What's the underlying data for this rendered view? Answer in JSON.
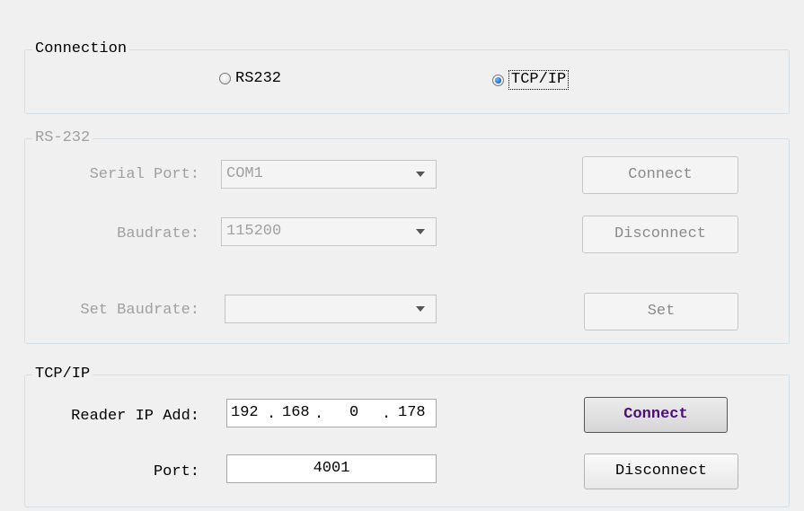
{
  "connection": {
    "title": "Connection",
    "options": [
      {
        "label": "RS232",
        "checked": false
      },
      {
        "label": "TCP/IP",
        "checked": true
      }
    ]
  },
  "rs232": {
    "title": "RS-232",
    "serial_port_label": "Serial Port:",
    "serial_port_value": "COM1",
    "baudrate_label": "Baudrate:",
    "baudrate_value": "115200",
    "set_baudrate_label": "Set Baudrate:",
    "set_baudrate_value": "",
    "connect_label": "Connect",
    "disconnect_label": "Disconnect",
    "set_label": "Set"
  },
  "tcpip": {
    "title": "TCP/IP",
    "ip_label": "Reader IP Add:",
    "ip_octets": [
      "192",
      "168",
      "0",
      "178"
    ],
    "port_label": "Port:",
    "port_value": "4001",
    "connect_label": "Connect",
    "disconnect_label": "Disconnect"
  },
  "colors": {
    "disabled_text": "#a0a0a0",
    "default_button_text": "#4b0d7a",
    "group_border": "#d5dfe5"
  },
  "icons": {
    "combo_arrow": "chevron-down-icon",
    "radio": "radio-button-icon"
  }
}
